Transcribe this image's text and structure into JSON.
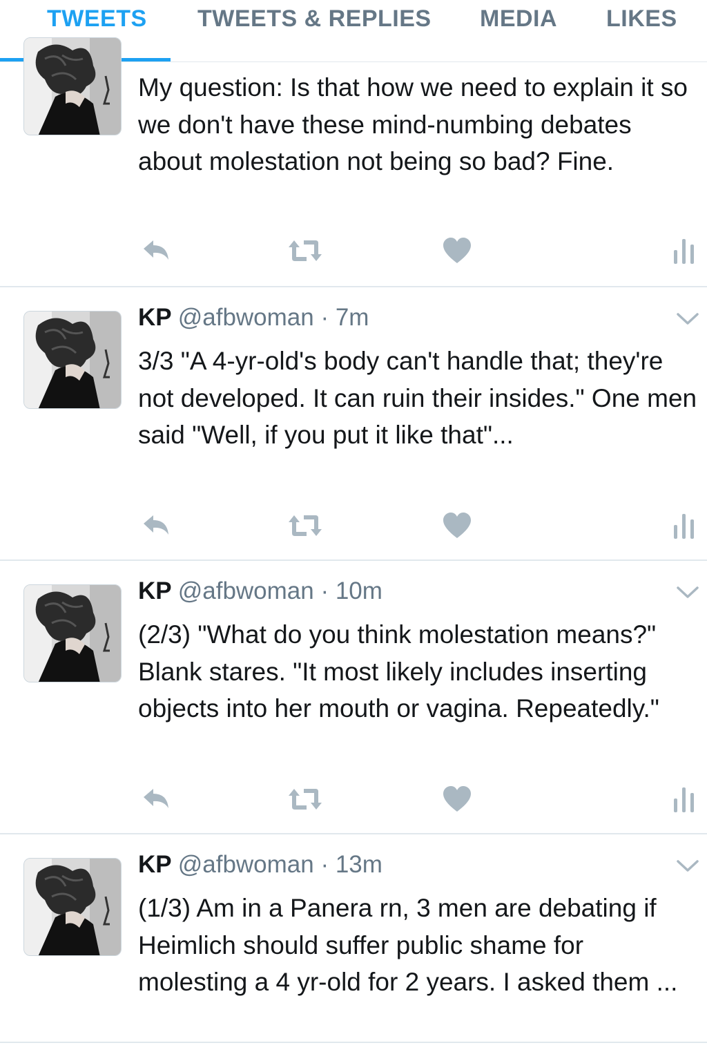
{
  "tabs": [
    {
      "label": "TWEETS",
      "active": true
    },
    {
      "label": "TWEETS & REPLIES",
      "active": false
    },
    {
      "label": "MEDIA",
      "active": false
    },
    {
      "label": "LIKES",
      "active": false
    }
  ],
  "colors": {
    "accent": "#1da1f2",
    "muted": "#657786",
    "action": "#aab8c2",
    "divider": "#e1e8ed"
  },
  "tweets": [
    {
      "partial": true,
      "text": "My question: Is that how we need to explain it so we don't have these mind-numbing debates about molestation not being so bad? Fine."
    },
    {
      "name": "KP",
      "handle": "@afbwoman",
      "dot": "·",
      "time": "7m",
      "text": "3/3 \"A 4-yr-old's body can't handle that; they're not developed. It can ruin their insides.\" One men said \"Well, if you put it like that\"..."
    },
    {
      "name": "KP",
      "handle": "@afbwoman",
      "dot": "·",
      "time": "10m",
      "text": "(2/3) \"What do you think molestation means?\" Blank stares. \"It most likely includes inserting objects into her mouth or vagina. Repeatedly.\""
    },
    {
      "name": "KP",
      "handle": "@afbwoman",
      "dot": "·",
      "time": "13m",
      "text": "(1/3) Am in a Panera rn, 3 men are debating if Heimlich should suffer public shame for molesting a 4 yr-old for 2 years. I asked them ..."
    }
  ],
  "icons": {
    "reply": "reply-icon",
    "retweet": "retweet-icon",
    "like": "heart-icon",
    "analytics": "analytics-icon",
    "menu": "chevron-down-icon"
  }
}
